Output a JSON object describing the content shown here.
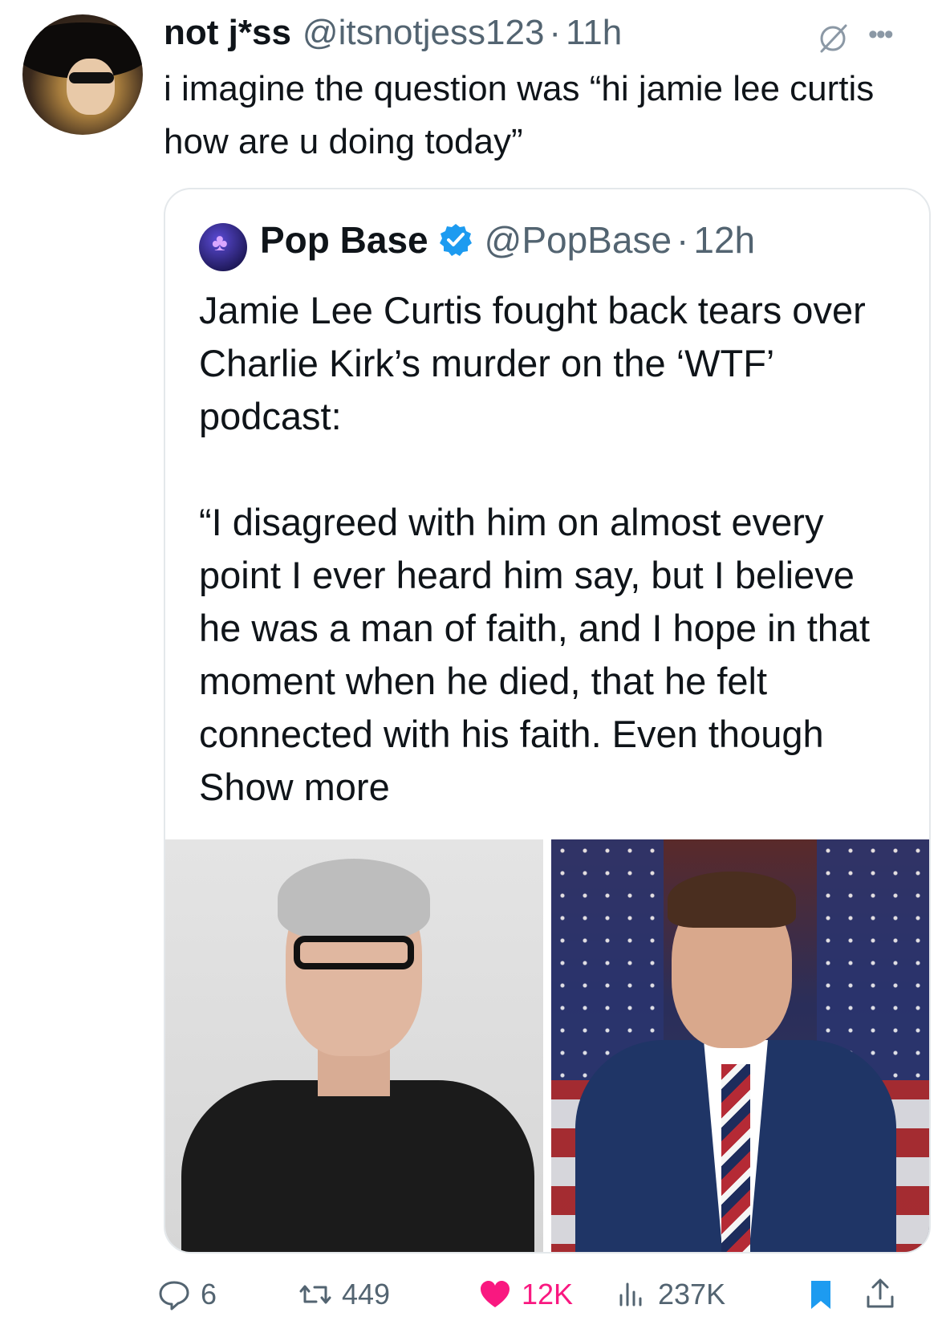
{
  "tweet": {
    "author_name": "not j*ss",
    "author_handle": "@itsnotjess123",
    "separator": "·",
    "time": "11h",
    "text": "i imagine the question was “hi jamie lee curtis how are u doing today”"
  },
  "quote": {
    "author_name": "Pop Base",
    "author_handle": "@PopBase",
    "separator": "·",
    "time": "12h",
    "text": "Jamie Lee Curtis fought back tears over Charlie Kirk’s murder on the ‘WTF’ podcast:\n\n“I disagreed with him on almost every point I ever heard him say, but I believe he was a man of faith, and I hope in that moment when he died, that he felt connected with his faith. Even though ",
    "show_more": "Show more"
  },
  "actions": {
    "replies": "6",
    "retweets": "449",
    "likes": "12K",
    "views": "237K"
  },
  "icons": {
    "reply": "reply-icon",
    "retweet": "retweet-icon",
    "like": "heart-icon",
    "views": "views-icon",
    "bookmark": "bookmark-icon",
    "share": "share-icon",
    "mute": "mute-icon",
    "more": "more-icon",
    "verified": "verified-badge-icon"
  },
  "colors": {
    "like": "#f91880",
    "verified": "#1d9bf0",
    "bookmark": "#1d9bf0",
    "secondary_text": "#536471"
  }
}
